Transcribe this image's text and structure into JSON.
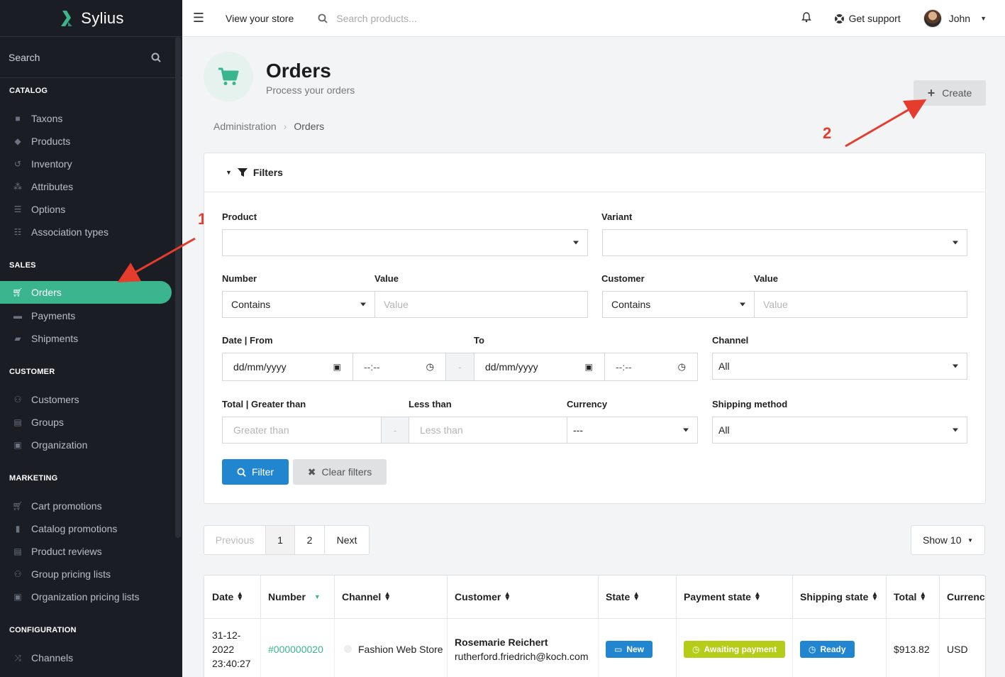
{
  "brand": {
    "name": "Sylius"
  },
  "sidebar": {
    "search_label": "Search",
    "sections": {
      "catalog": "CATALOG",
      "sales": "SALES",
      "customer": "CUSTOMER",
      "marketing": "MARKETING",
      "configuration": "CONFIGURATION"
    },
    "items": [
      {
        "label": "Taxons",
        "icon": "folder-icon"
      },
      {
        "label": "Products",
        "icon": "cube-icon"
      },
      {
        "label": "Inventory",
        "icon": "history-icon"
      },
      {
        "label": "Attributes",
        "icon": "cubes-icon"
      },
      {
        "label": "Options",
        "icon": "options-icon"
      },
      {
        "label": "Association types",
        "icon": "list-icon"
      },
      {
        "label": "Orders",
        "icon": "cart-icon",
        "active": true
      },
      {
        "label": "Payments",
        "icon": "payment-icon"
      },
      {
        "label": "Shipments",
        "icon": "truck-icon"
      },
      {
        "label": "Customers",
        "icon": "users-icon"
      },
      {
        "label": "Groups",
        "icon": "archive-icon"
      },
      {
        "label": "Organization",
        "icon": "briefcase-icon"
      },
      {
        "label": "Cart promotions",
        "icon": "cart-icon"
      },
      {
        "label": "Catalog promotions",
        "icon": "bookmark-icon"
      },
      {
        "label": "Product reviews",
        "icon": "newspaper-icon"
      },
      {
        "label": "Group pricing lists",
        "icon": "users-icon"
      },
      {
        "label": "Organization pricing lists",
        "icon": "briefcase-icon"
      },
      {
        "label": "Channels",
        "icon": "random-icon"
      }
    ]
  },
  "topbar": {
    "view_store": "View your store",
    "search_placeholder": "Search products...",
    "support": "Get support",
    "user": "John"
  },
  "page": {
    "title": "Orders",
    "subtitle": "Process your orders",
    "create_label": "Create",
    "breadcrumb": [
      "Administration",
      "Orders"
    ]
  },
  "annotations": {
    "first": "1",
    "second": "2",
    "color": "#e53c2e"
  },
  "filters": {
    "title": "Filters",
    "product_label": "Product",
    "variant_label": "Variant",
    "number_label": "Number",
    "number_value_label": "Value",
    "number_mode": "Contains",
    "number_value_placeholder": "Value",
    "customer_label": "Customer",
    "customer_value_label": "Value",
    "customer_mode": "Contains",
    "customer_value_placeholder": "Value",
    "date_from_label": "Date | From",
    "date_to_label": "To",
    "date_placeholder": "dd/mm/yyyy",
    "time_placeholder": "--:--",
    "dash": "-",
    "channel_label": "Channel",
    "channel_value": "All",
    "total_label": "Total | Greater than",
    "less_than_label": "Less than",
    "greater_placeholder": "Greater than",
    "less_placeholder": "Less than",
    "currency_label": "Currency",
    "currency_value": "---",
    "shipping_label": "Shipping method",
    "shipping_value": "All",
    "filter_button": "Filter",
    "clear_button": "Clear filters"
  },
  "pagination": {
    "previous": "Previous",
    "pages": [
      "1",
      "2"
    ],
    "current": "1",
    "next": "Next",
    "show": "Show 10"
  },
  "table": {
    "columns": [
      "Date",
      "Number",
      "Channel",
      "Customer",
      "State",
      "Payment state",
      "Shipping state",
      "Total",
      "Currency"
    ],
    "rows": [
      {
        "date_lines": [
          "31-12-",
          "2022",
          "23:40:27"
        ],
        "number": "#000000020",
        "channel": "Fashion Web Store",
        "customer_name": "Rosemarie Reichert",
        "customer_email": "rutherford.friedrich@koch.com",
        "state": "New",
        "payment_state": "Awaiting payment",
        "shipping_state": "Ready",
        "total": "$913.82",
        "currency": "USD"
      }
    ]
  },
  "colors": {
    "accent": "#3bb58e",
    "primary": "#2185d0",
    "payment_badge": "#b5cc18",
    "annotation": "#e53c2e"
  }
}
